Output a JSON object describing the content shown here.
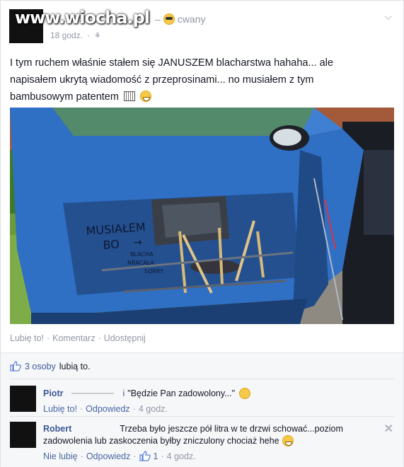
{
  "watermark": "www.wiocha.pl",
  "feeling": {
    "separator": "–",
    "label": "cwany",
    "icon": "sunglasses-smiley-icon"
  },
  "post": {
    "time": "18 godz.",
    "audience_icon": "friends-icon",
    "text_line1": "I tym ruchem właśnie stałem się JANUSZEM blacharstwa hahaha... ale",
    "text_line2": "napisałem ukrytą wiadomość z przeprosinami... no musiałem z tym",
    "text_line3": "bambusowym patentem",
    "photo_text": {
      "line1": "MUSIAŁEM",
      "line2": "BO",
      "line3": "BLACHA",
      "line4": "NRACAŁA",
      "line5": "SORRY"
    }
  },
  "actions": {
    "like": "Lubię to!",
    "comment": "Komentarz",
    "share": "Udostępnij",
    "dot": "·"
  },
  "likes": {
    "count": "3 osoby",
    "tail": "lubią to."
  },
  "comments": [
    {
      "name": "Piotr",
      "name_tail": "i",
      "text": "\"Będzie Pan zadowolony...\"",
      "like": "Lubię to!",
      "reply": "Odpowiedz",
      "time": "4 godz."
    },
    {
      "name": "Robert",
      "text_line1": "Trzeba było jeszcze pół litra w te drzwi schować...poziom",
      "text_line2": "zadowolenia lub zaskoczenia byłby zniczulony chociaż hehe",
      "like": "Nie lubię",
      "reply": "Odpowiedz",
      "like_count": "1",
      "time": "4 godz."
    }
  ],
  "colors": {
    "link": "#3b5998",
    "meta": "#9197a3",
    "car_blue": "#2f6fc4"
  }
}
